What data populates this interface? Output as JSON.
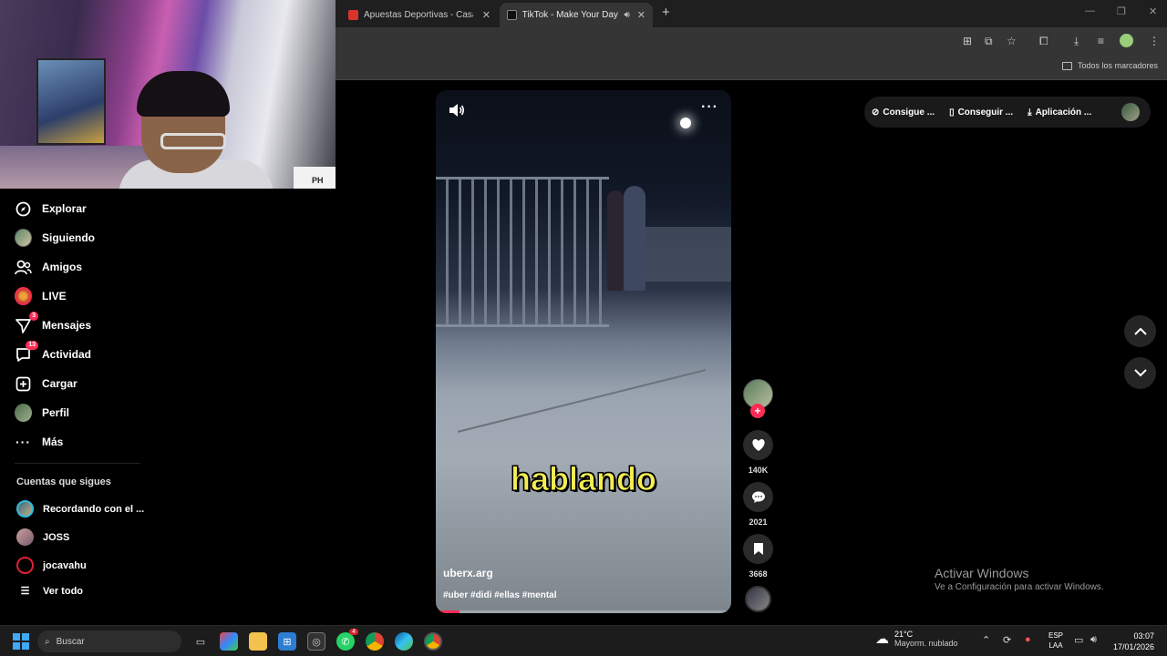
{
  "browser": {
    "tabs": [
      {
        "label": "Apuestas Deportivas - Casa de",
        "active": false,
        "favicon_color": "#d9342b"
      },
      {
        "label": "TikTok - Make Your Day",
        "active": true,
        "favicon_color": "#111111"
      }
    ],
    "bookmarks_label": "Todos los marcadores"
  },
  "webcam": {
    "box_text": "PH"
  },
  "sidebar": {
    "nav": [
      {
        "label": "Explorar",
        "icon": "compass-icon",
        "badge": ""
      },
      {
        "label": "Siguiendo",
        "icon": "avatar-icon",
        "badge": ""
      },
      {
        "label": "Amigos",
        "icon": "friends-icon",
        "badge": ""
      },
      {
        "label": "LIVE",
        "icon": "live-icon",
        "badge": ""
      },
      {
        "label": "Mensajes",
        "icon": "send-icon",
        "badge": "3"
      },
      {
        "label": "Actividad",
        "icon": "notification-icon",
        "badge": "13"
      },
      {
        "label": "Cargar",
        "icon": "upload-icon",
        "badge": ""
      },
      {
        "label": "Perfil",
        "icon": "profile-icon",
        "badge": ""
      },
      {
        "label": "Más",
        "icon": "more-icon",
        "badge": ""
      }
    ],
    "following_title": "Cuentas que sigues",
    "following": [
      {
        "name": "Recordando con el ..."
      },
      {
        "name": "JOSS"
      },
      {
        "name": "jocavahu"
      }
    ],
    "see_all": "Ver todo"
  },
  "video": {
    "caption": "hablando",
    "author": "uberx.arg",
    "hashtags": "#uber #didi #ellas #mental",
    "progress": 0.08
  },
  "actions": {
    "likes": "140K",
    "comments": "2021",
    "saves": "3668"
  },
  "top_pill": {
    "items": [
      "Consigue ...",
      "Conseguir ...",
      "Aplicación ..."
    ]
  },
  "watermark": {
    "line1": "Activar Windows",
    "line2": "Ve a Configuración para activar Windows."
  },
  "taskbar": {
    "search": "Buscar",
    "whatsapp_badge": "4",
    "weather_temp": "21°C",
    "weather_desc": "Mayorm. nublado",
    "lang1": "ESP",
    "lang2": "LAA",
    "time": "03:07",
    "date": "17/01/2026"
  },
  "colors": {
    "accent": "#fe2c55",
    "caption": "#f3ee52"
  }
}
